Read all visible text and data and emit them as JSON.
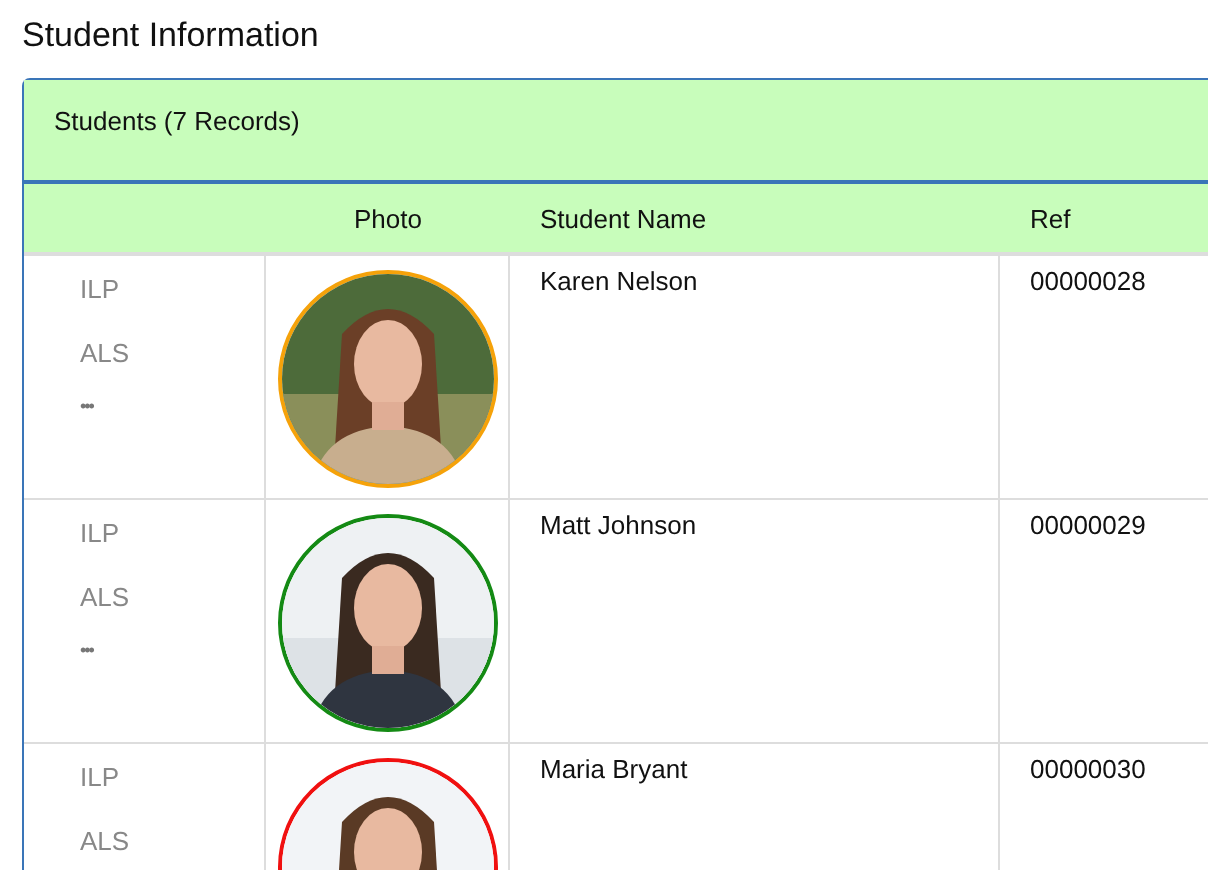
{
  "page_title": "Student Information",
  "panel": {
    "heading": "Students (7 Records)"
  },
  "table": {
    "columns": [
      "",
      "Photo",
      "Student Name",
      "Ref"
    ],
    "rows": [
      {
        "links": [
          "ILP",
          "ALS"
        ],
        "more": "•••",
        "photo": {
          "kind": "picture"
        },
        "color": "#f5a20a",
        "name": "Karen Nelson",
        "ref": "00000028"
      },
      {
        "links": [
          "ILP",
          "ALS"
        ],
        "more": "•••",
        "photo": {
          "kind": "picture"
        },
        "color": "#148a14",
        "name": "Matt Johnson",
        "ref": "00000029"
      },
      {
        "links": [
          "ILP",
          "ALS"
        ],
        "photo": {
          "kind": "picture"
        },
        "color": "#f01010",
        "name": "Maria Bryant",
        "ref": "00000030"
      }
    ]
  }
}
